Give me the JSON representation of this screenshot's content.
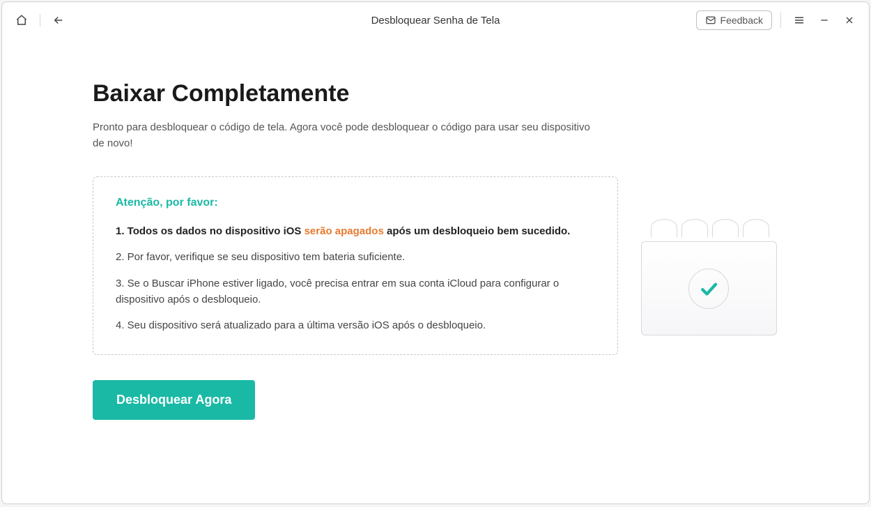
{
  "header": {
    "title": "Desbloquear Senha de Tela",
    "feedback_label": "Feedback"
  },
  "main": {
    "heading": "Baixar Completamente",
    "subtitle": "Pronto para desbloquear o código de tela. Agora você pode desbloquear o código para usar seu dispositivo de novo!",
    "notice": {
      "title": "Atenção, por favor:",
      "item1_prefix": "1. Todos os dados no dispositivo iOS ",
      "item1_highlight": "serão apagados",
      "item1_suffix": " após um desbloqueio bem sucedido.",
      "item2": "2. Por favor, verifique se seu dispositivo tem bateria suficiente.",
      "item3": "3. Se o Buscar iPhone estiver ligado, você precisa entrar em sua conta iCloud para configurar o dispositivo após o desbloqueio.",
      "item4": "4. Seu dispositivo será atualizado para a última versão iOS após o desbloqueio."
    },
    "action_button": "Desbloquear Agora"
  },
  "colors": {
    "accent": "#1ab9a5",
    "highlight": "#e77a2f"
  }
}
